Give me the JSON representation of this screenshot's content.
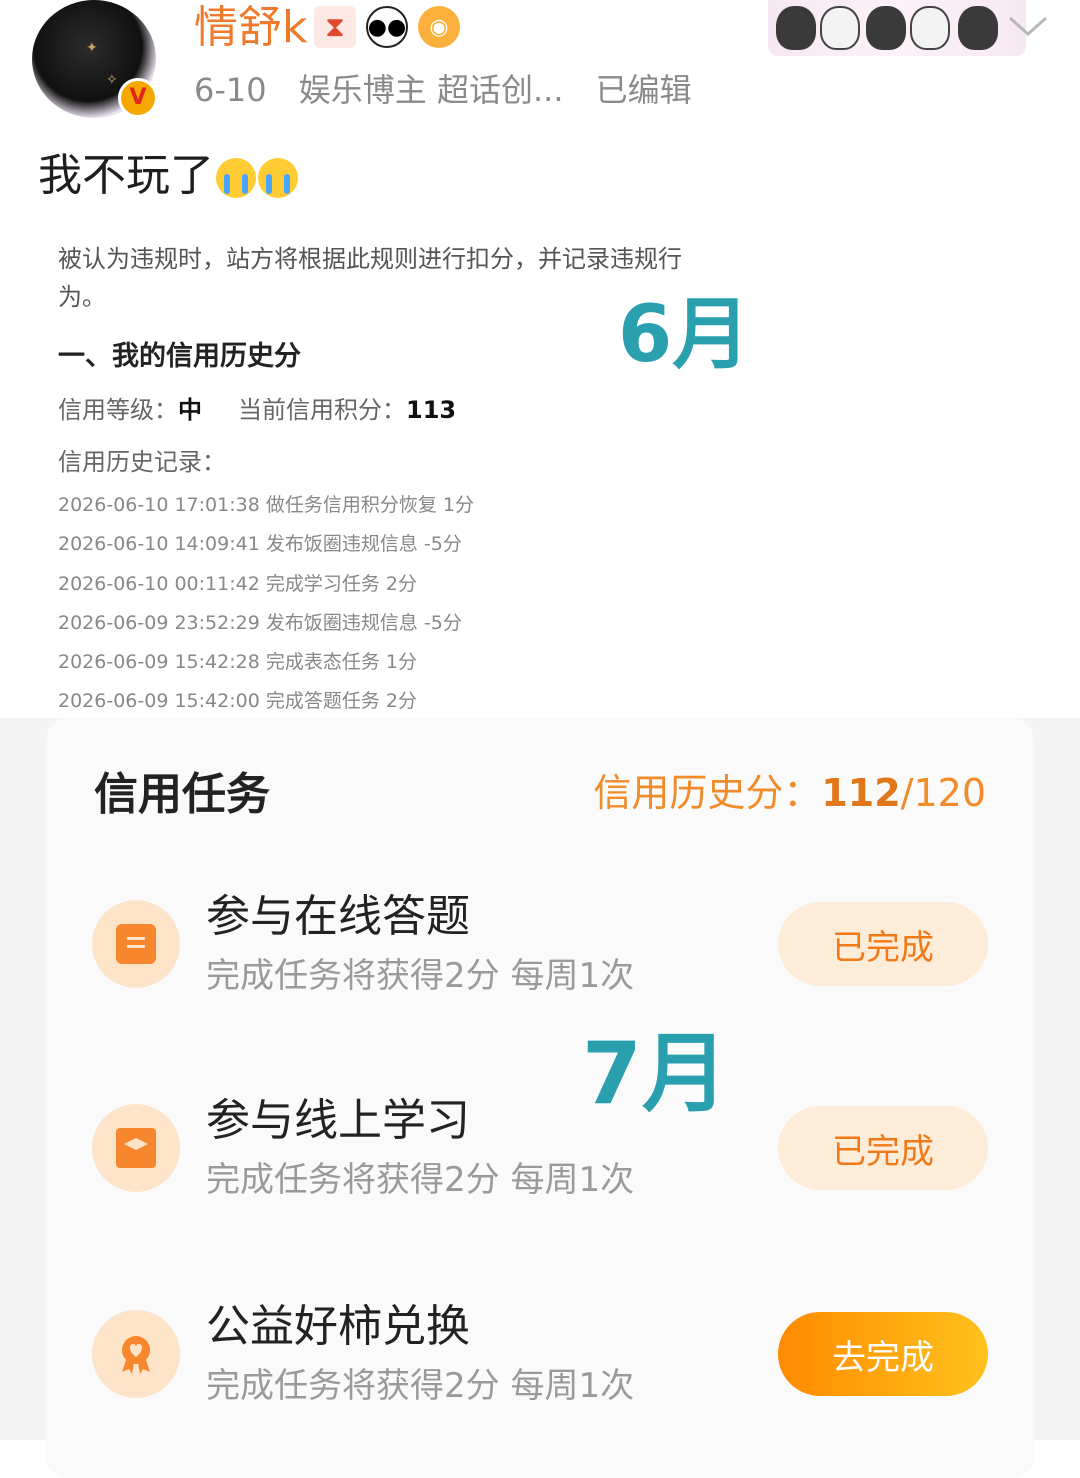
{
  "post": {
    "username": "情舒k",
    "username_emojis": [
      "hourglass-icon",
      "panda-icon",
      "pufferfish-icon"
    ],
    "date": "6-10",
    "tags": "娱乐博主 超话创...",
    "edited": "已编辑",
    "text": "我不玩了",
    "text_emojis": [
      "crying-face-icon",
      "crying-face-icon"
    ],
    "verified_badge": "V"
  },
  "june_screenshot": {
    "rule_text": "被认为违规时，站方将根据此规则进行扣分，并记录违规行为。",
    "section_title": "一、我的信用历史分",
    "credit_level_label": "信用等级：",
    "credit_level_value": "中",
    "current_score_label": "当前信用积分：",
    "current_score_value": "113",
    "history_label": "信用历史记录：",
    "history": [
      "2026-06-10 17:01:38 做任务信用积分恢复 1分",
      "2026-06-10 14:09:41 发布饭圈违规信息 -5分",
      "2026-06-10 00:11:42 完成学习任务 2分",
      "2026-06-09 23:52:29 发布饭圈违规信息 -5分",
      "2026-06-09 15:42:28 完成表态任务 1分",
      "2026-06-09 15:42:00 完成答题任务 2分"
    ],
    "month_overlay": "6月"
  },
  "july_screenshot": {
    "card_title": "信用任务",
    "score_label": "信用历史分：",
    "score_current": "112",
    "score_total": "/120",
    "month_overlay": "7月",
    "tasks": [
      {
        "name": "参与在线答题",
        "desc": "完成任务将获得2分 每周1次",
        "button": "已完成",
        "state": "done",
        "icon": "clipboard-icon"
      },
      {
        "name": "参与线上学习",
        "desc": "完成任务将获得2分 每周1次",
        "button": "已完成",
        "state": "done",
        "icon": "graduation-monitor-icon"
      },
      {
        "name": "公益好柿兑换",
        "desc": "完成任务将获得2分 每周1次",
        "button": "去完成",
        "state": "todo",
        "icon": "heart-ribbon-icon"
      }
    ]
  },
  "colors": {
    "username": "#f07a2c",
    "month_overlay": "#2a9fae",
    "score_orange": "#f08c2a",
    "button_done_bg": "#fdecd8",
    "button_todo_gradient": [
      "#ff8a00",
      "#ffc21e"
    ]
  }
}
